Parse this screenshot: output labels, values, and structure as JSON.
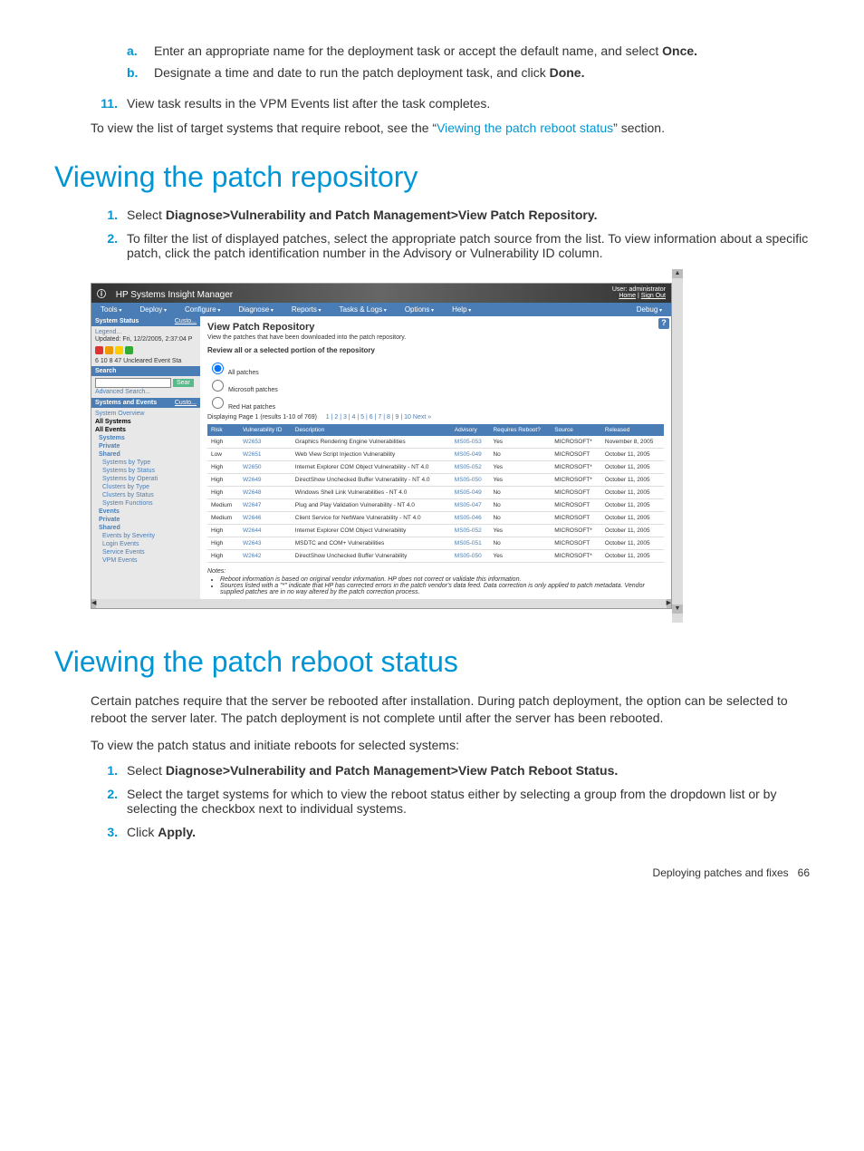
{
  "intro": {
    "sub_a_label": "a.",
    "sub_a_text_1": "Enter an appropriate name for the deployment task or accept the default name, and select ",
    "sub_a_bold": "Once.",
    "sub_b_label": "b.",
    "sub_b_text_1": "Designate a time and date to run the patch deployment task, and click ",
    "sub_b_bold": "Done.",
    "step11_num": "11.",
    "step11_text": "View task results in the VPM Events list after the task completes.",
    "after_text_1": "To view the list of target systems that require reboot, see the “",
    "after_link": "Viewing the patch reboot status",
    "after_text_2": "” section."
  },
  "sec1": {
    "heading": "Viewing the patch repository",
    "step1_num": "1.",
    "step1_text": "Select ",
    "step1_bold": "Diagnose>Vulnerability and Patch Management>View Patch Repository.",
    "step2_num": "2.",
    "step2_text": "To filter the list of displayed patches, select the appropriate patch source from the list. To view information about a specific patch, click the patch identification number in the Advisory or Vulnerability ID column."
  },
  "shot": {
    "title": "HP Systems Insight Manager",
    "user_label": "User: administrator",
    "home": "Home",
    "signout": "Sign Out",
    "menus": [
      "Tools",
      "Deploy",
      "Configure",
      "Diagnose",
      "Reports",
      "Tasks & Logs",
      "Options",
      "Help",
      "Debug"
    ],
    "sidebar": {
      "status_head": "System Status",
      "customize": "Custo...",
      "legend": "Legend...",
      "updated": "Updated: Fri, 12/2/2005, 2:37:04 P",
      "counts": "6  10  8  47 Uncleared Event Sta",
      "search_head": "Search",
      "search_btn": "Sear",
      "adv_search": "Advanced Search...",
      "se_head": "Systems and Events",
      "customize2": "Custo...",
      "overview": "System Overview",
      "all_systems": "All Systems",
      "all_events": "All Events",
      "tree": {
        "systems": "Systems",
        "private": "Private",
        "shared": "Shared",
        "sbt": "Systems by Type",
        "sbs": "Systems by Status",
        "sbo": "Systems by Operati",
        "cbt": "Clusters by Type",
        "cbs": "Clusters by Status",
        "sf": "System Functions",
        "events": "Events",
        "private2": "Private",
        "shared2": "Shared",
        "ebs": "Events by Severity",
        "le": "Login Events",
        "se": "Service Events",
        "vpm": "VPM Events"
      }
    },
    "main": {
      "title": "View Patch Repository",
      "subtitle": "View the patches that have been downloaded into the patch repository.",
      "section": "Review all or a selected portion of the repository",
      "r1": "All patches",
      "r2": "Microsoft patches",
      "r3": "Red Hat patches",
      "pager_text": "Displaying Page 1 (results 1-10 of 769)",
      "pager_links": "1 | 2 | 3 | 4 | 5 | 6 | 7 | 8 | 9 | 10   Next »",
      "cols": [
        "Risk",
        "Vulnerability ID",
        "Description",
        "Advisory",
        "Requires Reboot?",
        "Source",
        "Released"
      ],
      "rows": [
        {
          "risk": "High",
          "vid": "W2653",
          "desc": "Graphics Rendering Engine Vulnerabilities",
          "adv": "MS05-053",
          "reboot": "Yes",
          "src": "MICROSOFT*",
          "rel": "November 8, 2005"
        },
        {
          "risk": "Low",
          "vid": "W2651",
          "desc": "Web View Script Injection Vulnerability",
          "adv": "MS05-049",
          "reboot": "No",
          "src": "MICROSOFT",
          "rel": "October 11, 2005"
        },
        {
          "risk": "High",
          "vid": "W2650",
          "desc": "Internet Explorer COM Object Vulnerability - NT 4.0",
          "adv": "MS05-052",
          "reboot": "Yes",
          "src": "MICROSOFT*",
          "rel": "October 11, 2005"
        },
        {
          "risk": "High",
          "vid": "W2649",
          "desc": "DirectShow Unchecked Buffer Vulnerability - NT 4.0",
          "adv": "MS05-050",
          "reboot": "Yes",
          "src": "MICROSOFT*",
          "rel": "October 11, 2005"
        },
        {
          "risk": "High",
          "vid": "W2648",
          "desc": "Windows Shell Link Vulnerabilities - NT 4.0",
          "adv": "MS05-049",
          "reboot": "No",
          "src": "MICROSOFT",
          "rel": "October 11, 2005"
        },
        {
          "risk": "Medium",
          "vid": "W2647",
          "desc": "Plug and Play Validation Vulnerability - NT 4.0",
          "adv": "MS05-047",
          "reboot": "No",
          "src": "MICROSOFT",
          "rel": "October 11, 2005"
        },
        {
          "risk": "Medium",
          "vid": "W2646",
          "desc": "Client Service for NetWare Vulnerability - NT 4.0",
          "adv": "MS05-046",
          "reboot": "No",
          "src": "MICROSOFT",
          "rel": "October 11, 2005"
        },
        {
          "risk": "High",
          "vid": "W2644",
          "desc": "Internet Explorer COM Object Vulnerability",
          "adv": "MS05-052",
          "reboot": "Yes",
          "src": "MICROSOFT*",
          "rel": "October 11, 2005"
        },
        {
          "risk": "High",
          "vid": "W2643",
          "desc": "MSDTC and COM+ Vulnerabilities",
          "adv": "MS05-051",
          "reboot": "No",
          "src": "MICROSOFT",
          "rel": "October 11, 2005"
        },
        {
          "risk": "High",
          "vid": "W2642",
          "desc": "DirectShow Unchecked Buffer Vulnerability",
          "adv": "MS05-050",
          "reboot": "Yes",
          "src": "MICROSOFT*",
          "rel": "October 11, 2005"
        }
      ],
      "notes_head": "Notes:",
      "note1": "Reboot information is based on original vendor information. HP does not correct or validate this information.",
      "note2": "Sources listed with a \"*\" indicate that HP has corrected errors in the patch vendor's data feed. Data correction is only applied to patch metadata. Vendor supplied patches are in no way altered by the patch correction process."
    }
  },
  "sec2": {
    "heading": "Viewing the patch reboot status",
    "p1": "Certain patches require that the server be rebooted after installation. During patch deployment, the option can be selected to reboot the server later. The patch deployment is not complete until after the server has been rebooted.",
    "p2": "To view the patch status and initiate reboots for selected systems:",
    "step1_num": "1.",
    "step1_text": "Select ",
    "step1_bold": "Diagnose>Vulnerability and Patch Management>View Patch Reboot Status.",
    "step2_num": "2.",
    "step2_text": "Select the target systems for which to view the reboot status either by selecting a group from the dropdown list or by selecting the checkbox next to individual systems.",
    "step3_num": "3.",
    "step3_text": "Click ",
    "step3_bold": "Apply."
  },
  "footer": {
    "text": "Deploying patches and fixes",
    "page": "66"
  }
}
